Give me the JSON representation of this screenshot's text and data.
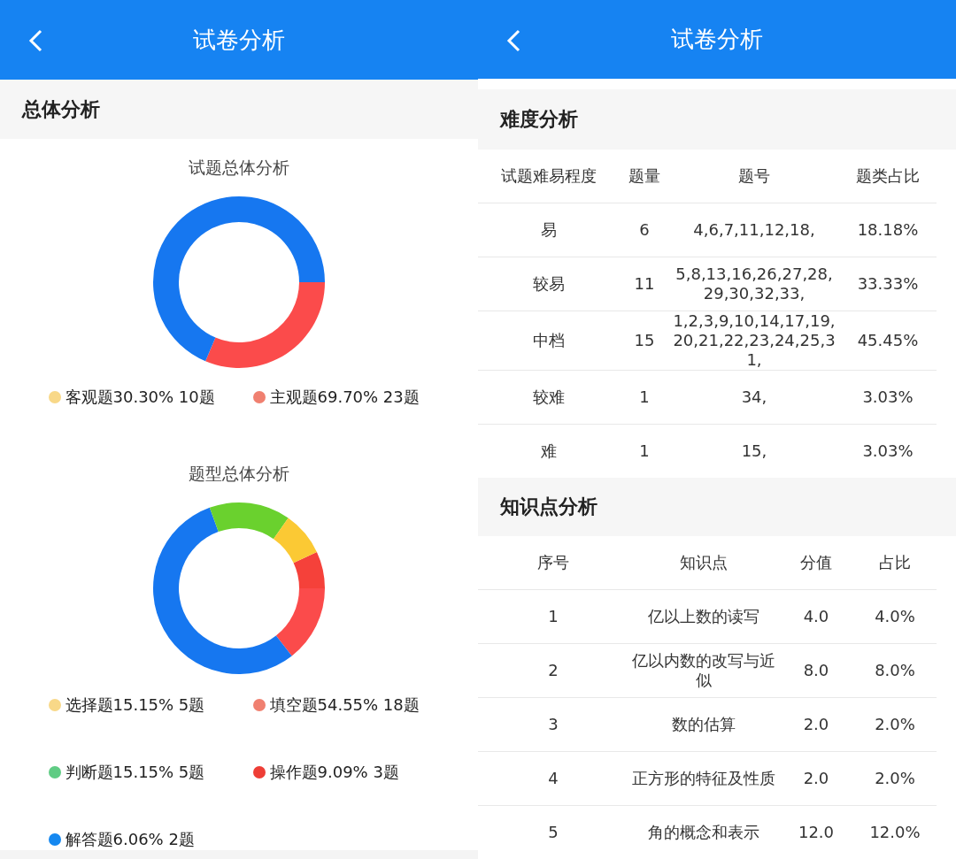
{
  "left_screen": {
    "header": {
      "title": "试卷分析"
    },
    "section": {
      "title": "总体分析"
    },
    "charts": [
      {
        "title": "试题总体分析",
        "legend": [
          {
            "label": "客观题30.30%  10题",
            "color": "#f8d888"
          },
          {
            "label": "主观题69.70%  23题",
            "color": "#f08070"
          }
        ]
      },
      {
        "title": "题型总体分析",
        "legend": [
          {
            "label": "选择题15.15%  5题",
            "color": "#f8d888"
          },
          {
            "label": "填空题54.55%  18题",
            "color": "#f08070"
          },
          {
            "label": "判断题15.15%  5题",
            "color": "#60cc84"
          },
          {
            "label": "操作题9.09%  3题",
            "color": "#ee3e36"
          },
          {
            "label": "解答题6.06%  2题",
            "color": "#1588f0"
          }
        ]
      }
    ]
  },
  "right_screen": {
    "header": {
      "title": "试卷分析"
    },
    "difficulty": {
      "title": "难度分析",
      "columns": [
        "试题难易程度",
        "题量",
        "题号",
        "题类占比"
      ],
      "rows": [
        [
          "易",
          "6",
          "4,6,7,11,12,18,",
          "18.18%"
        ],
        [
          "较易",
          "11",
          "5,8,13,16,26,27,28,29,30,32,33,",
          "33.33%"
        ],
        [
          "中档",
          "15",
          "1,2,3,9,10,14,17,19,20,21,22,23,24,25,31,",
          "45.45%"
        ],
        [
          "较难",
          "1",
          "34,",
          "3.03%"
        ],
        [
          "难",
          "1",
          "15,",
          "3.03%"
        ]
      ]
    },
    "knowledge": {
      "title": "知识点分析",
      "columns": [
        "序号",
        "知识点",
        "分值",
        "占比"
      ],
      "rows": [
        [
          "1",
          "亿以上数的读写",
          "4.0",
          "4.0%"
        ],
        [
          "2",
          "亿以内数的改写与近似",
          "8.0",
          "8.0%"
        ],
        [
          "3",
          "数的估算",
          "2.0",
          "2.0%"
        ],
        [
          "4",
          "正方形的特征及性质",
          "2.0",
          "2.0%"
        ],
        [
          "5",
          "角的概念和表示",
          "12.0",
          "12.0%"
        ]
      ]
    }
  }
}
